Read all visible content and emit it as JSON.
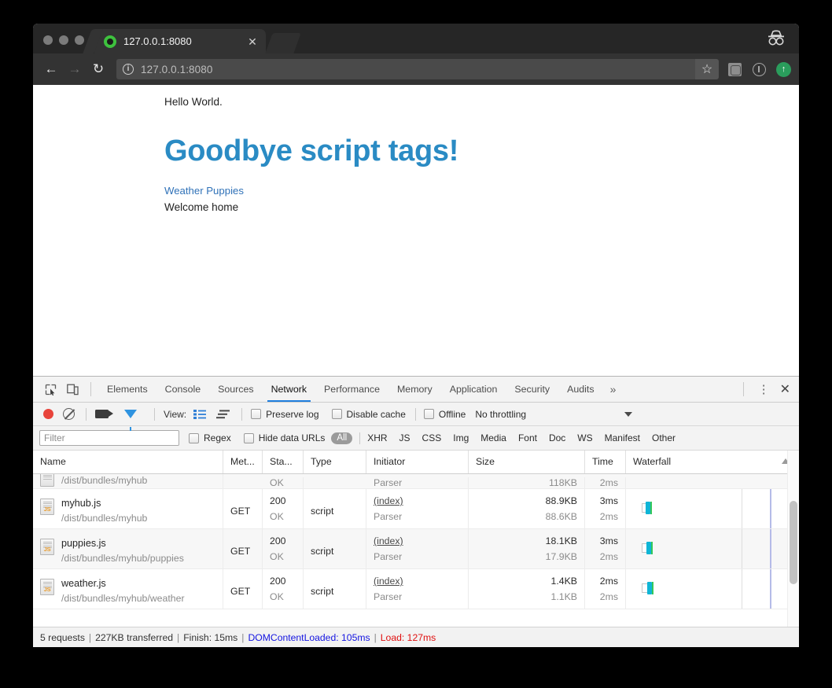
{
  "browser": {
    "tab": {
      "title": "127.0.0.1:8080",
      "favicon": "green-circle-favicon",
      "close_label": "✕"
    },
    "new_tab_label": "",
    "incognito_label": "incognito-icon",
    "nav": {
      "back_label": "←",
      "forward_label": "→",
      "reload_label": "↻",
      "info_label": "i",
      "url": "127.0.0.1:8080",
      "star_label": "☆",
      "extensions_label": "extensions-icon",
      "update_label": "↑"
    }
  },
  "page": {
    "hello": "Hello World.",
    "heading": "Goodbye script tags!",
    "link": "Weather Puppies",
    "welcome": "Welcome home",
    "heading_color": "#2a8bc4",
    "link_color": "#3072b8"
  },
  "devtools": {
    "tabs": [
      {
        "label": "Elements",
        "active": false
      },
      {
        "label": "Console",
        "active": false
      },
      {
        "label": "Sources",
        "active": false
      },
      {
        "label": "Network",
        "active": true
      },
      {
        "label": "Performance",
        "active": false
      },
      {
        "label": "Memory",
        "active": false
      },
      {
        "label": "Application",
        "active": false
      },
      {
        "label": "Security",
        "active": false
      },
      {
        "label": "Audits",
        "active": false
      }
    ],
    "more_label": "»",
    "kebab_label": "⋮",
    "close_label": "✕",
    "inspect_label": "inspect-element-icon",
    "device_label": "device-toolbar-icon",
    "toolbar": {
      "record_label": "record-button",
      "clear_label": "clear-button",
      "capture_screenshots_label": "camera-icon",
      "filter_label": "funnel-icon",
      "view_label": "View:",
      "view_list_label": "list-view-icon",
      "view_waterfall_label": "waterfall-view-icon",
      "preserve_log": "Preserve log",
      "disable_cache": "Disable cache",
      "offline": "Offline",
      "throttling": "No throttling",
      "throttling_caret": "▼"
    },
    "filterbar": {
      "filter_value": "",
      "filter_placeholder": "Filter",
      "regex": "Regex",
      "hide_data_urls": "Hide data URLs",
      "types": [
        "All",
        "XHR",
        "JS",
        "CSS",
        "Img",
        "Media",
        "Font",
        "Doc",
        "WS",
        "Manifest",
        "Other"
      ],
      "active_type": "All"
    },
    "table": {
      "columns": [
        "Name",
        "Met...",
        "Sta...",
        "Type",
        "Initiator",
        "Size",
        "Time",
        "Waterfall"
      ],
      "sort_caret": "▲",
      "rows": [
        {
          "name": "",
          "path": "/dist/bundles/myhub",
          "method": "",
          "status_code": "",
          "status_text": "OK",
          "type": "",
          "initiator_link": "",
          "initiator_sub": "Parser",
          "size": "",
          "size_sub": "118KB",
          "time": "",
          "time_sub": "2ms",
          "clipped": true
        },
        {
          "name": "myhub.js",
          "path": "/dist/bundles/myhub",
          "method": "GET",
          "status_code": "200",
          "status_text": "OK",
          "type": "script",
          "initiator_link": "(index)",
          "initiator_sub": "Parser",
          "size": "88.9KB",
          "size_sub": "88.6KB",
          "time": "3ms",
          "time_sub": "2ms",
          "clipped": false
        },
        {
          "name": "puppies.js",
          "path": "/dist/bundles/myhub/puppies",
          "method": "GET",
          "status_code": "200",
          "status_text": "OK",
          "type": "script",
          "initiator_link": "(index)",
          "initiator_sub": "Parser",
          "size": "18.1KB",
          "size_sub": "17.9KB",
          "time": "3ms",
          "time_sub": "2ms",
          "clipped": false
        },
        {
          "name": "weather.js",
          "path": "/dist/bundles/myhub/weather",
          "method": "GET",
          "status_code": "200",
          "status_text": "OK",
          "type": "script",
          "initiator_link": "(index)",
          "initiator_sub": "Parser",
          "size": "1.4KB",
          "size_sub": "1.1KB",
          "time": "2ms",
          "time_sub": "2ms",
          "clipped": false
        }
      ]
    },
    "statusbar": {
      "requests": "5 requests",
      "transferred": "227KB transferred",
      "finish": "Finish: 15ms",
      "domcontentloaded": "DOMContentLoaded: 105ms",
      "load": "Load: 127ms",
      "separator": "|",
      "domcontentloaded_color": "#1414e0",
      "load_color": "#e01010"
    }
  }
}
